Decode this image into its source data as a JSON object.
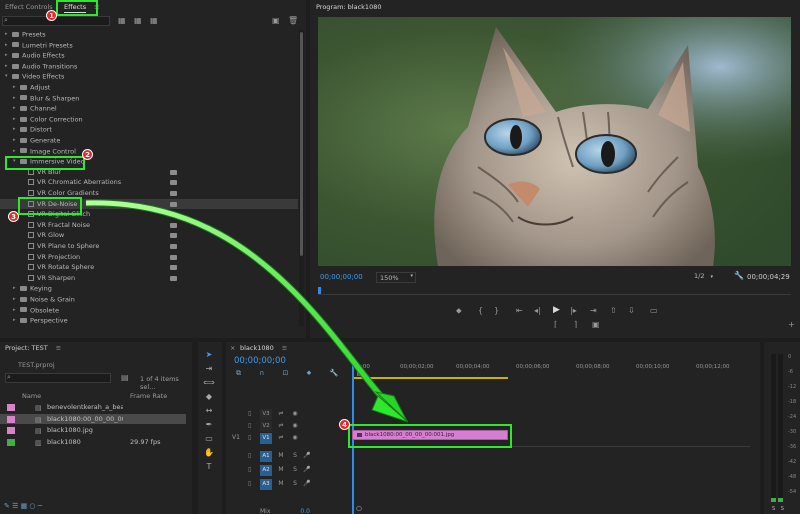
{
  "effects_panel": {
    "tab_effect_controls": "Effect Controls",
    "tab_effects": "Effects",
    "menu_glyph": "≡",
    "items": [
      {
        "label": "Presets",
        "level": 0,
        "kind": "folder"
      },
      {
        "label": "Lumetri Presets",
        "level": 0,
        "kind": "folder"
      },
      {
        "label": "Audio Effects",
        "level": 0,
        "kind": "folder"
      },
      {
        "label": "Audio Transitions",
        "level": 0,
        "kind": "folder"
      },
      {
        "label": "Video Effects",
        "level": 0,
        "kind": "folder",
        "open": true
      },
      {
        "label": "Adjust",
        "level": 1,
        "kind": "folder"
      },
      {
        "label": "Blur & Sharpen",
        "level": 1,
        "kind": "folder"
      },
      {
        "label": "Channel",
        "level": 1,
        "kind": "folder"
      },
      {
        "label": "Color Correction",
        "level": 1,
        "kind": "folder"
      },
      {
        "label": "Distort",
        "level": 1,
        "kind": "folder"
      },
      {
        "label": "Generate",
        "level": 1,
        "kind": "folder"
      },
      {
        "label": "Image Control",
        "level": 1,
        "kind": "folder"
      },
      {
        "label": "Immersive Video",
        "level": 1,
        "kind": "folder",
        "open": true
      },
      {
        "label": "VR Blur",
        "level": 2,
        "kind": "effect"
      },
      {
        "label": "VR Chromatic Aberrations",
        "level": 2,
        "kind": "effect"
      },
      {
        "label": "VR Color Gradients",
        "level": 2,
        "kind": "effect"
      },
      {
        "label": "VR De-Noise",
        "level": 2,
        "kind": "effect",
        "selected": true
      },
      {
        "label": "VR Digital Glitch",
        "level": 2,
        "kind": "effect"
      },
      {
        "label": "VR Fractal Noise",
        "level": 2,
        "kind": "effect"
      },
      {
        "label": "VR Glow",
        "level": 2,
        "kind": "effect"
      },
      {
        "label": "VR Plane to Sphere",
        "level": 2,
        "kind": "effect"
      },
      {
        "label": "VR Projection",
        "level": 2,
        "kind": "effect"
      },
      {
        "label": "VR Rotate Sphere",
        "level": 2,
        "kind": "effect"
      },
      {
        "label": "VR Sharpen",
        "level": 2,
        "kind": "effect"
      },
      {
        "label": "Keying",
        "level": 1,
        "kind": "folder"
      },
      {
        "label": "Noise & Grain",
        "level": 1,
        "kind": "folder"
      },
      {
        "label": "Obsolete",
        "level": 1,
        "kind": "folder"
      },
      {
        "label": "Perspective",
        "level": 1,
        "kind": "folder"
      }
    ]
  },
  "program_monitor": {
    "title": "Program: black1080",
    "timecode_left": "00;00;00;00",
    "zoom": "150%",
    "resolution": "1/2",
    "timecode_right": "00;00;04;29"
  },
  "project_panel": {
    "title": "Project: TEST",
    "menu_glyph": "≡",
    "file": "TEST.prproj",
    "count": "1 of 4 items sel...",
    "col_name": "Name",
    "col_rate": "Frame Rate",
    "items": [
      {
        "name": "benevolentkerah_a_beauti",
        "rate": "",
        "color": "#d782c9"
      },
      {
        "name": "black1080:00_00_00_00:001",
        "rate": "",
        "color": "#d782c9"
      },
      {
        "name": "black1080.jpg",
        "rate": "",
        "color": "#d782c9"
      },
      {
        "name": "black1080",
        "rate": "29.97 fps",
        "color": "#3fae49"
      }
    ]
  },
  "timeline": {
    "tab_name": "black1080",
    "menu_glyph": "≡",
    "timecode": "00;00;00;00",
    "ruler": [
      "00;00",
      "00;00;02;00",
      "00;00;04;00",
      "00;00;06;00",
      "00;00;08;00",
      "00;00;10;00",
      "00;00;12;00"
    ],
    "video_tracks": [
      "V3",
      "V2",
      "V1"
    ],
    "audio_tracks": [
      "A1",
      "A2",
      "A3"
    ],
    "v1_source": "V1",
    "mix_label": "Mix",
    "mix_value": "0.0",
    "clip_label": "black1080:00_00_00_00:001.jpg",
    "letter_m": "M",
    "letter_s": "S"
  },
  "audio_meter": {
    "scale": [
      "0",
      "-6",
      "-12",
      "-18",
      "-24",
      "-30",
      "-36",
      "-42",
      "-48",
      "-54"
    ],
    "solo": [
      "S",
      "S"
    ]
  },
  "annotations": [
    "1",
    "2",
    "3",
    "4"
  ],
  "colors": {
    "highlight": "#2ee82e",
    "badge": "#e8262b",
    "clip": "#d57fd0",
    "selection_blue": "#2d8ceb"
  }
}
